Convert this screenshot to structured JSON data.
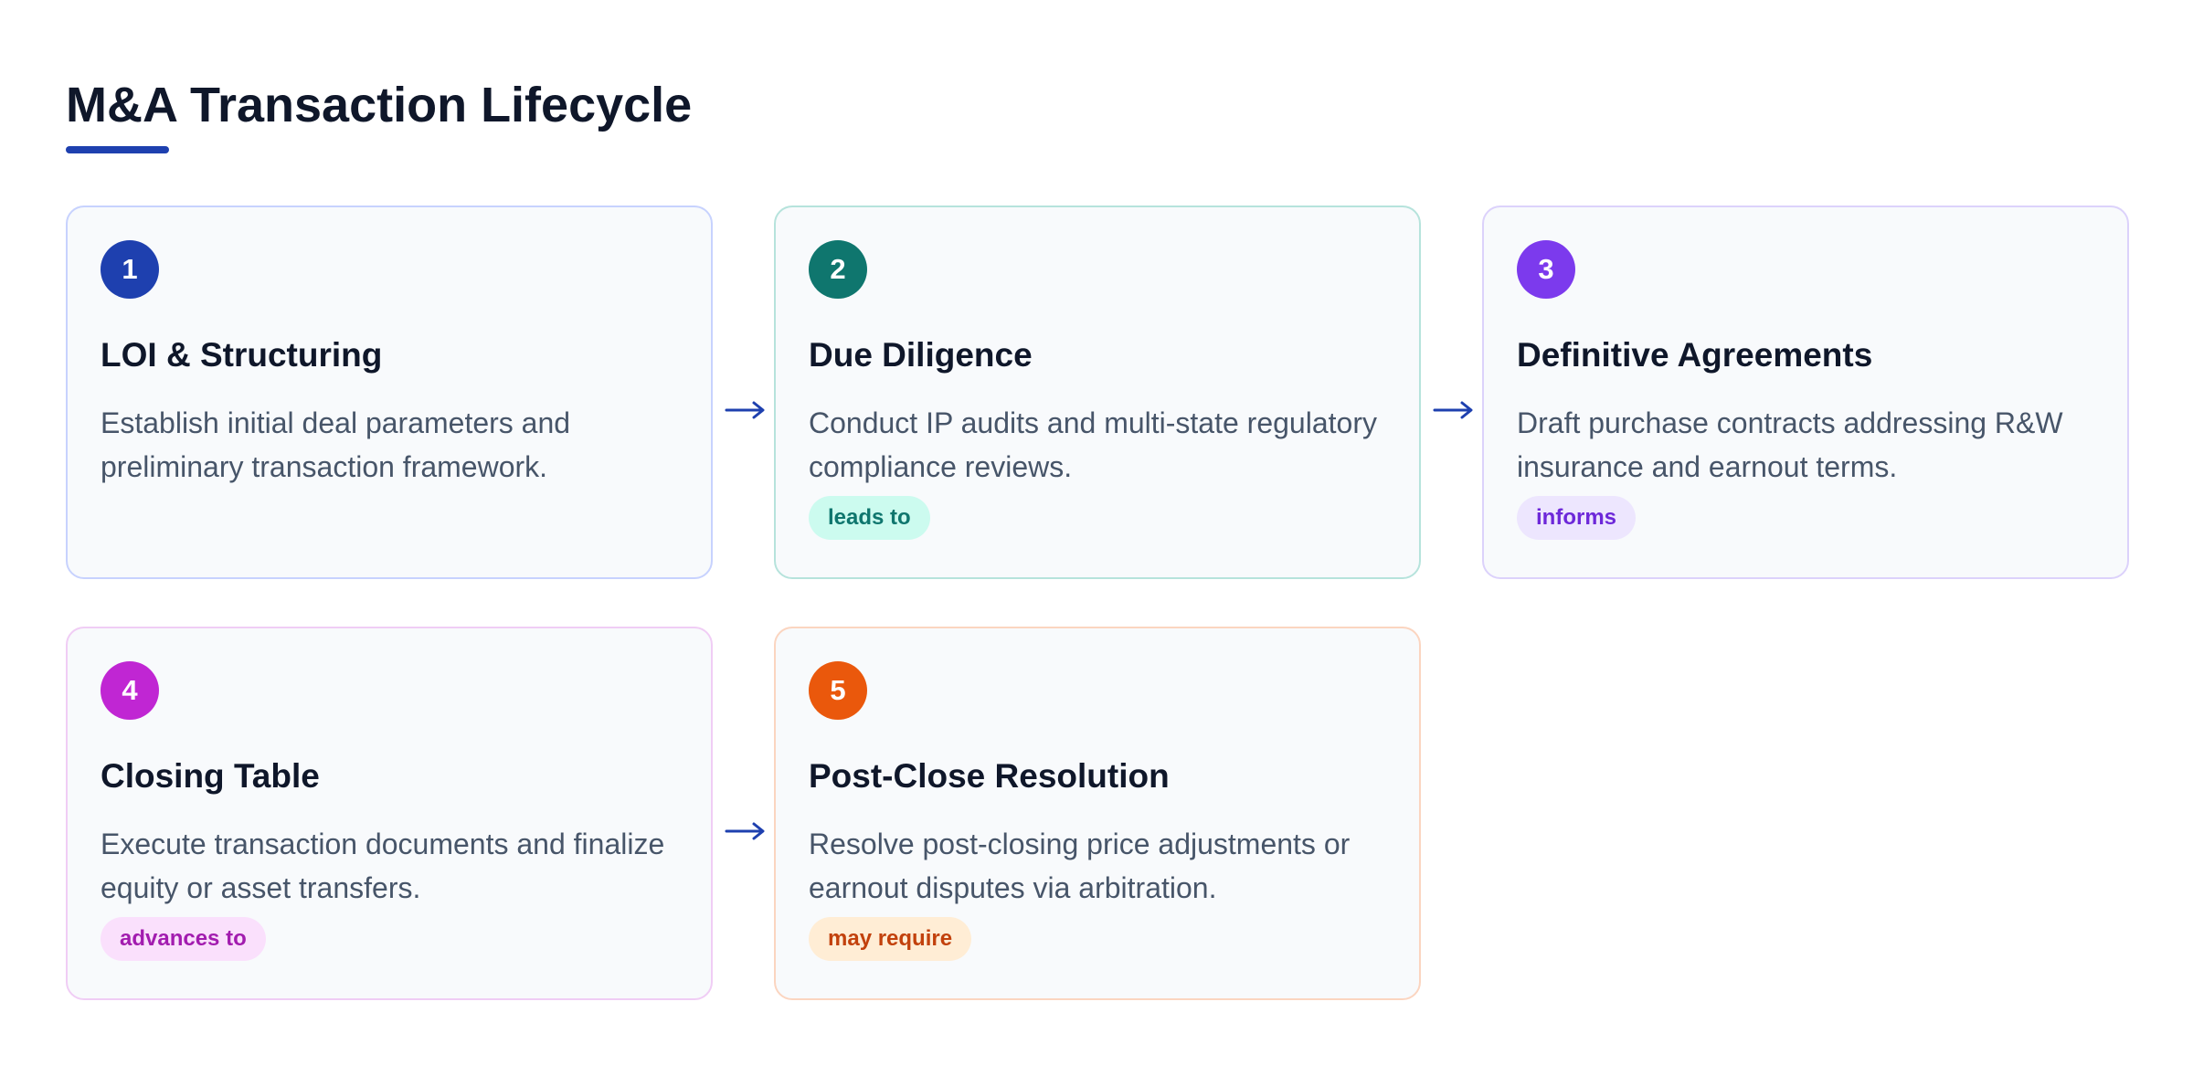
{
  "page": {
    "title": "M&A Transaction Lifecycle",
    "accent_color": "#1e40af"
  },
  "steps": [
    {
      "number": "1",
      "title": "LOI & Structuring",
      "description": "Establish initial deal parameters and preliminary transaction framework.",
      "relation": "",
      "color": "#1e40af",
      "border_color": "#c7d2fe",
      "tag_bg": "#e0e7ff",
      "tag_text": "#1e40af"
    },
    {
      "number": "2",
      "title": "Due Diligence",
      "description": "Conduct IP audits and multi-state regulatory compliance reviews.",
      "relation": "leads to",
      "color": "#0f766e",
      "border_color": "#b6e3dc",
      "tag_bg": "#ccfbef",
      "tag_text": "#0f766e"
    },
    {
      "number": "3",
      "title": "Definitive Agreements",
      "description": "Draft purchase contracts addressing R&W insurance and earnout terms.",
      "relation": "informs",
      "color": "#7c3aed",
      "border_color": "#dcd2fb",
      "tag_bg": "#ede6fe",
      "tag_text": "#6d28d9"
    },
    {
      "number": "4",
      "title": "Closing Table",
      "description": "Execute transaction documents and finalize equity or asset transfers.",
      "relation": "advances to",
      "color": "#c026d3",
      "border_color": "#f0cdf5",
      "tag_bg": "#fae0fc",
      "tag_text": "#a21caf"
    },
    {
      "number": "5",
      "title": "Post-Close Resolution",
      "description": "Resolve post-closing price adjustments or earnout disputes via arbitration.",
      "relation": "may require",
      "color": "#ea580c",
      "border_color": "#fbd5c0",
      "tag_bg": "#ffedd5",
      "tag_text": "#c2410c"
    }
  ],
  "arrows": [
    {
      "from": 1,
      "to": 2,
      "icon": "arrow-right-icon"
    },
    {
      "from": 2,
      "to": 3,
      "icon": "arrow-right-icon"
    },
    {
      "from": 4,
      "to": 5,
      "icon": "arrow-right-icon"
    }
  ]
}
